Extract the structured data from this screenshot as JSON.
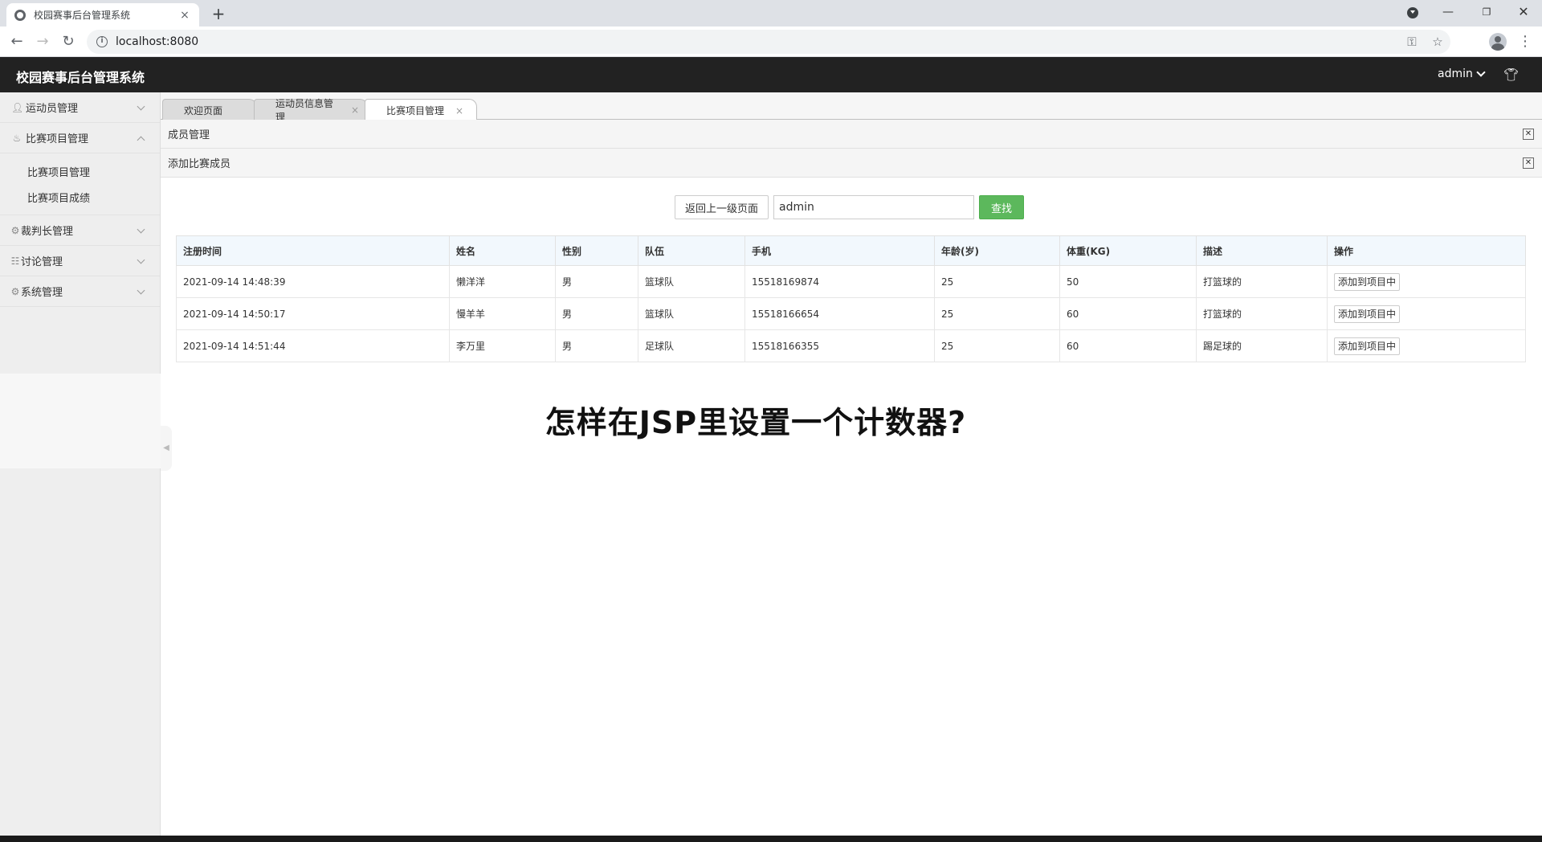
{
  "browser": {
    "tab_title": "校园赛事后台管理系统",
    "tab_close": "×",
    "new_tab": "+",
    "url": "localhost:8080"
  },
  "header": {
    "title": "校园赛事后台管理系统",
    "user": "admin"
  },
  "sidebar": {
    "groups": [
      {
        "label": "运动员管理",
        "icon": "user-icon"
      },
      {
        "label": "比赛项目管理",
        "icon": "fire-icon",
        "children": [
          "比赛项目管理",
          "比赛项目成绩"
        ]
      },
      {
        "label": "裁判长管理",
        "icon": "gear-icon"
      },
      {
        "label": "讨论管理",
        "icon": "list-icon"
      },
      {
        "label": "系统管理",
        "icon": "gear-icon"
      }
    ]
  },
  "tabs": [
    {
      "label": "欢迎页面"
    },
    {
      "label": "运动员信息管理"
    },
    {
      "label": "比赛项目管理"
    }
  ],
  "panels": {
    "members": "成员管理",
    "add_member": "添加比赛成员"
  },
  "search": {
    "back_label": "返回上一级页面",
    "value": "admin",
    "find_label": "查找"
  },
  "table": {
    "headers": [
      "注册时间",
      "姓名",
      "性别",
      "队伍",
      "手机",
      "年龄(岁)",
      "体重(KG)",
      "描述",
      "操作"
    ],
    "rows": [
      [
        "2021-09-14 14:48:39",
        "懒洋洋",
        "男",
        "篮球队",
        "15518169874",
        "25",
        "50",
        "打篮球的"
      ],
      [
        "2021-09-14 14:50:17",
        "慢羊羊",
        "男",
        "篮球队",
        "15518166654",
        "25",
        "60",
        "打篮球的"
      ],
      [
        "2021-09-14 14:51:44",
        "李万里",
        "男",
        "足球队",
        "15518166355",
        "25",
        "60",
        "踢足球的"
      ]
    ],
    "action_label": "添加到项目中"
  },
  "overlay_text": "怎样在JSP里设置一个计数器?"
}
